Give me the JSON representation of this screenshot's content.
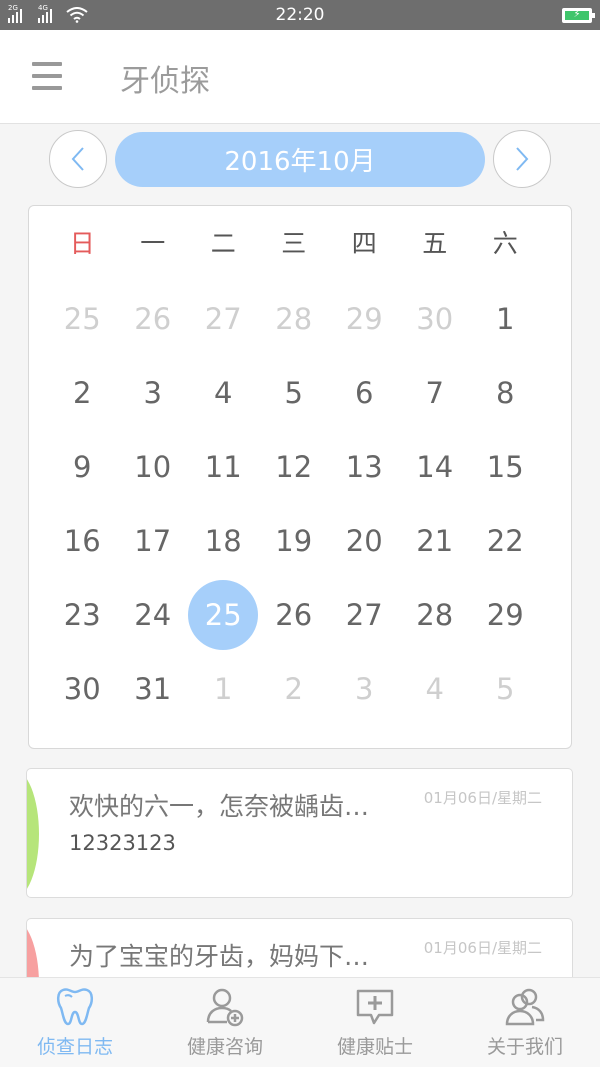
{
  "status_bar": {
    "network_1": "2G",
    "network_2": "4G",
    "time": "22:20",
    "wifi_icon": "wifi-icon",
    "battery_icon": "battery-charging-icon",
    "battery_color": "#3fc56b"
  },
  "header": {
    "menu_icon": "menu-icon",
    "title": "牙侦探"
  },
  "month_nav": {
    "prev_icon": "chevron-left-icon",
    "next_icon": "chevron-right-icon",
    "current_month": "2016年10月",
    "accent_color": "#a6cffa"
  },
  "calendar": {
    "weekdays": [
      "日",
      "一",
      "二",
      "三",
      "四",
      "五",
      "六"
    ],
    "days": [
      {
        "d": "25",
        "other": true
      },
      {
        "d": "26",
        "other": true
      },
      {
        "d": "27",
        "other": true
      },
      {
        "d": "28",
        "other": true
      },
      {
        "d": "29",
        "other": true
      },
      {
        "d": "30",
        "other": true
      },
      {
        "d": "1"
      },
      {
        "d": "2"
      },
      {
        "d": "3"
      },
      {
        "d": "4"
      },
      {
        "d": "5"
      },
      {
        "d": "6"
      },
      {
        "d": "7"
      },
      {
        "d": "8"
      },
      {
        "d": "9"
      },
      {
        "d": "10"
      },
      {
        "d": "11"
      },
      {
        "d": "12"
      },
      {
        "d": "13"
      },
      {
        "d": "14"
      },
      {
        "d": "15"
      },
      {
        "d": "16"
      },
      {
        "d": "17"
      },
      {
        "d": "18"
      },
      {
        "d": "19"
      },
      {
        "d": "20"
      },
      {
        "d": "21"
      },
      {
        "d": "22"
      },
      {
        "d": "23"
      },
      {
        "d": "24"
      },
      {
        "d": "25",
        "selected": true
      },
      {
        "d": "26"
      },
      {
        "d": "27"
      },
      {
        "d": "28"
      },
      {
        "d": "29"
      },
      {
        "d": "30"
      },
      {
        "d": "31"
      },
      {
        "d": "1",
        "other": true
      },
      {
        "d": "2",
        "other": true
      },
      {
        "d": "3",
        "other": true
      },
      {
        "d": "4",
        "other": true
      },
      {
        "d": "5",
        "other": true
      }
    ]
  },
  "entries": [
    {
      "title": "欢快的六一，怎奈被龋齿…",
      "date": "01月06日/星期二",
      "body": "12323123",
      "stripe_color": "#b6e57a"
    },
    {
      "title": "为了宝宝的牙齿，妈妈下…",
      "date": "01月06日/星期二",
      "stripe_color": "#f7a0a0"
    }
  ],
  "tabs": [
    {
      "label": "侦查日志",
      "icon": "tooth-icon",
      "active": true
    },
    {
      "label": "健康咨询",
      "icon": "user-add-icon"
    },
    {
      "label": "健康贴士",
      "icon": "chat-plus-icon"
    },
    {
      "label": "关于我们",
      "icon": "users-icon"
    }
  ],
  "colors": {
    "active_tab": "#7fb9f2",
    "inactive_tab": "#9a9a9a",
    "sunday": "#e45b5b"
  }
}
